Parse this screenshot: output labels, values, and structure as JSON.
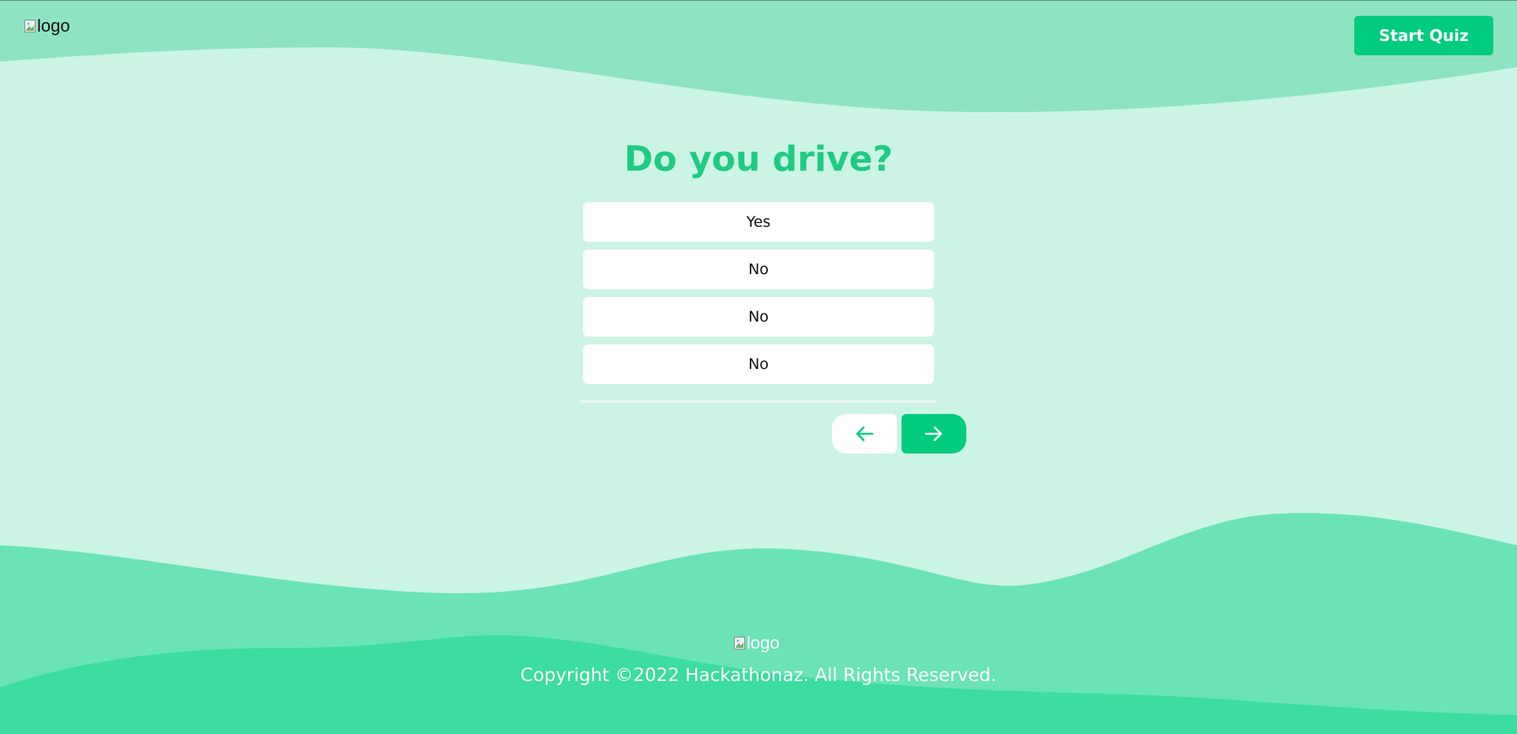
{
  "header": {
    "logo_alt": "logo",
    "start_button_label": "Start Quiz"
  },
  "quiz": {
    "question": "Do you drive?",
    "options": [
      {
        "label": "Yes"
      },
      {
        "label": "No"
      },
      {
        "label": "No"
      },
      {
        "label": "No"
      }
    ]
  },
  "navigation": {
    "prev_icon": "arrow-left-icon",
    "next_icon": "arrow-right-icon"
  },
  "footer": {
    "logo_alt": "logo",
    "copyright": "Copyright ©2022 Hackathonaz. All Rights Reserved."
  },
  "colors": {
    "brand_green": "#00cc7e",
    "heading_green": "#1fcb83",
    "page_background": "#ccf4e4",
    "wave_light": "#8ee3c2",
    "wave_mid": "#6ae3b7",
    "wave_dark": "#3ddca0"
  }
}
